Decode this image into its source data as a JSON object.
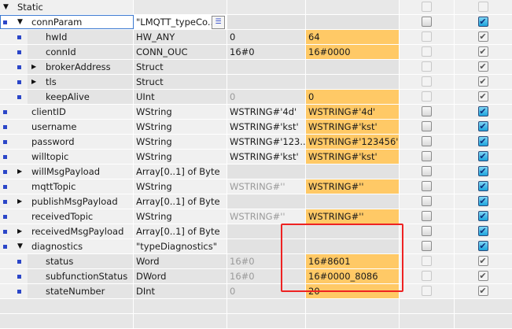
{
  "colors": {
    "monitor_value_bg": "#ffc966",
    "highlight_box": "#ee2222",
    "bullet": "#2b46c8"
  },
  "rows": [
    {
      "name": "Static",
      "level": 0,
      "toggle": "expanded",
      "bullet": false,
      "type": "",
      "default": "",
      "monitor": "",
      "cb1": "dim-off",
      "cb2": "dim-off",
      "section": true
    },
    {
      "name": "connParam",
      "level": 1,
      "toggle": "expanded",
      "bullet": true,
      "type": "\"LMQTT_typeCo...",
      "default": "",
      "monitor": "",
      "cb1": "off",
      "cb2": "on",
      "selected": true
    },
    {
      "name": "hwId",
      "level": 2,
      "bullet": true,
      "type": "HW_ANY",
      "default": "0",
      "monitor": "64",
      "cb1": "dis",
      "cb2": "dis-on"
    },
    {
      "name": "connId",
      "level": 2,
      "bullet": true,
      "type": "CONN_OUC",
      "default": "16#0",
      "monitor": "16#0000",
      "cb1": "dis",
      "cb2": "dis-on"
    },
    {
      "name": "brokerAddress",
      "level": 2,
      "toggle": "collapsed",
      "bullet": true,
      "type": "Struct",
      "default": "",
      "monitor": "",
      "cb1": "dis",
      "cb2": "dis-on"
    },
    {
      "name": "tls",
      "level": 2,
      "toggle": "collapsed",
      "bullet": true,
      "type": "Struct",
      "default": "",
      "monitor": "",
      "cb1": "dis",
      "cb2": "dis-on"
    },
    {
      "name": "keepAlive",
      "level": 2,
      "bullet": true,
      "type": "UInt",
      "default": "0",
      "default_gray": true,
      "monitor": "0",
      "cb1": "dis",
      "cb2": "dis-on"
    },
    {
      "name": "clientID",
      "level": 1,
      "bullet": true,
      "type": "WString",
      "default": "WSTRING#'4d'",
      "monitor": "WSTRING#'4d'",
      "cb1": "off",
      "cb2": "on"
    },
    {
      "name": "username",
      "level": 1,
      "bullet": true,
      "type": "WString",
      "default": "WSTRING#'kst'",
      "monitor": "WSTRING#'kst'",
      "cb1": "off",
      "cb2": "on"
    },
    {
      "name": "password",
      "level": 1,
      "bullet": true,
      "type": "WString",
      "default": "WSTRING#'123...",
      "monitor": "WSTRING#'123456'",
      "cb1": "off",
      "cb2": "on"
    },
    {
      "name": "willtopic",
      "level": 1,
      "bullet": true,
      "type": "WString",
      "default": "WSTRING#'kst'",
      "monitor": "WSTRING#'kst'",
      "cb1": "off",
      "cb2": "on"
    },
    {
      "name": "willMsgPayload",
      "level": 1,
      "toggle": "collapsed",
      "bullet": true,
      "type": "Array[0..1] of Byte",
      "default": "",
      "monitor": "",
      "cb1": "off",
      "cb2": "on"
    },
    {
      "name": "mqttTopic",
      "level": 1,
      "bullet": true,
      "type": "WString",
      "default": "WSTRING#''",
      "default_gray": true,
      "monitor": "WSTRING#''",
      "cb1": "off",
      "cb2": "on"
    },
    {
      "name": "publishMsgPayload",
      "level": 1,
      "toggle": "collapsed",
      "bullet": true,
      "type": "Array[0..1] of Byte",
      "default": "",
      "monitor": "",
      "cb1": "off",
      "cb2": "on"
    },
    {
      "name": "receivedTopic",
      "level": 1,
      "bullet": true,
      "type": "WString",
      "default": "WSTRING#''",
      "default_gray": true,
      "monitor": "WSTRING#''",
      "cb1": "off",
      "cb2": "on"
    },
    {
      "name": "receivedMsgPayload",
      "level": 1,
      "toggle": "collapsed",
      "bullet": true,
      "type": "Array[0..1] of Byte",
      "default": "",
      "monitor": "",
      "cb1": "off",
      "cb2": "on"
    },
    {
      "name": "diagnostics",
      "level": 1,
      "toggle": "expanded",
      "bullet": true,
      "type": "\"typeDiagnostics\"",
      "default": "",
      "monitor": "",
      "cb1": "off",
      "cb2": "on"
    },
    {
      "name": "status",
      "level": 2,
      "bullet": true,
      "type": "Word",
      "default": "16#0",
      "default_gray": true,
      "monitor": "16#8601",
      "cb1": "dis",
      "cb2": "dis-on"
    },
    {
      "name": "subfunctionStatus",
      "level": 2,
      "bullet": true,
      "type": "DWord",
      "default": "16#0",
      "default_gray": true,
      "monitor": "16#0000_8086",
      "cb1": "dis",
      "cb2": "dis-on"
    },
    {
      "name": "stateNumber",
      "level": 2,
      "bullet": true,
      "type": "DInt",
      "default": "0",
      "default_gray": true,
      "monitor": "20",
      "cb1": "dis",
      "cb2": "dis-on"
    }
  ]
}
